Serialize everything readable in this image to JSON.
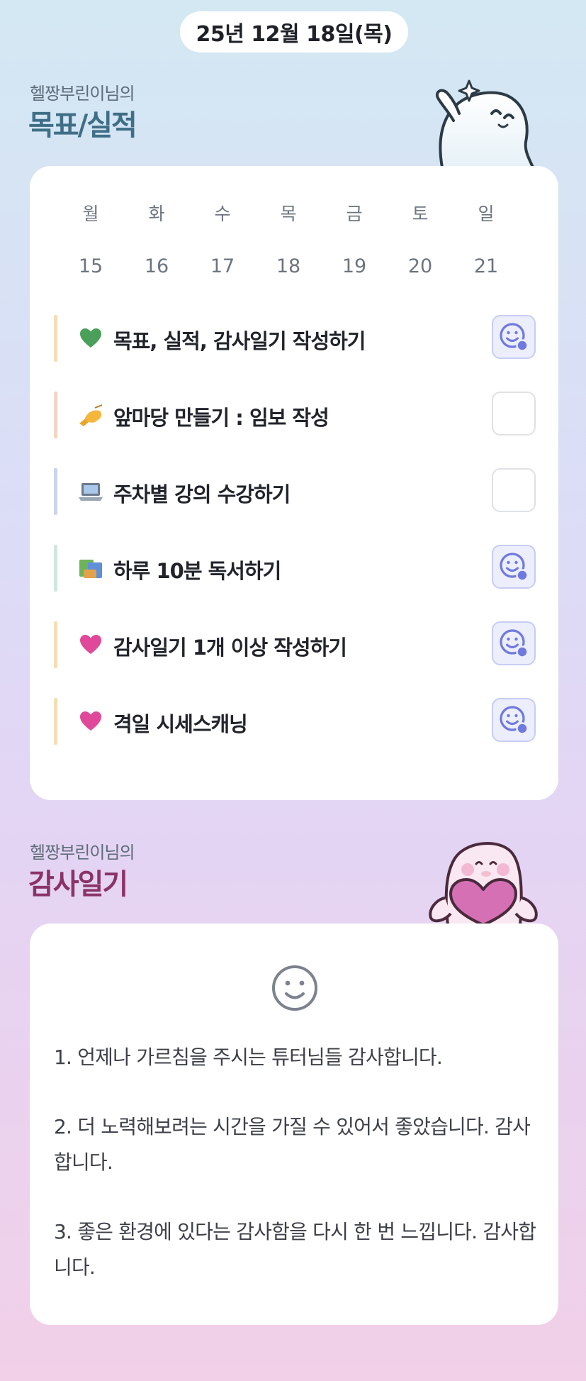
{
  "date": "25년 12월 18일(목)",
  "goals": {
    "owner": "헬짱부린이님의",
    "title": "목표/실적",
    "week": {
      "days": [
        "월",
        "화",
        "수",
        "목",
        "금",
        "토",
        "일"
      ],
      "dates": [
        "15",
        "16",
        "17",
        "18",
        "19",
        "20",
        "21"
      ]
    },
    "items": [
      {
        "emoji": "green-heart-icon",
        "label": "목표, 실적, 감사일기 작성하기",
        "done": true,
        "accent": "#f6dcb0"
      },
      {
        "emoji": "writing-hand-icon",
        "label": "앞마당 만들기 : 임보 작성",
        "done": false,
        "accent": "#f7d2c2"
      },
      {
        "emoji": "laptop-icon",
        "label": "주차별 강의 수강하기",
        "done": false,
        "accent": "#cbd3ef"
      },
      {
        "emoji": "books-icon",
        "label": "하루 10분 독서하기",
        "done": true,
        "accent": "#cfe7dd"
      },
      {
        "emoji": "pink-heart-icon",
        "label": "감사일기 1개 이상 작성하기",
        "done": true,
        "accent": "#f6dcb0"
      },
      {
        "emoji": "pink-heart-icon",
        "label": "격일 시세스캐닝",
        "done": true,
        "accent": "#f6dcb0"
      }
    ]
  },
  "gratitude": {
    "owner": "헬짱부린이님의",
    "title": "감사일기",
    "lines": [
      "1. 언제나 가르침을 주시는 튜터님들 감사합니다.",
      "2. 더 노력해보려는 시간을 가질 수 있어서 좋았습니다. 감사합니다.",
      "3. 좋은 환경에 있다는 감사함을 다시 한 번 느낍니다. 감사합니다."
    ]
  },
  "colors": {
    "goal_title": "#3e6f86",
    "gratitude_title": "#8a3368",
    "check_done_bg": "#eceefc",
    "check_done_icon": "#6f79df"
  }
}
